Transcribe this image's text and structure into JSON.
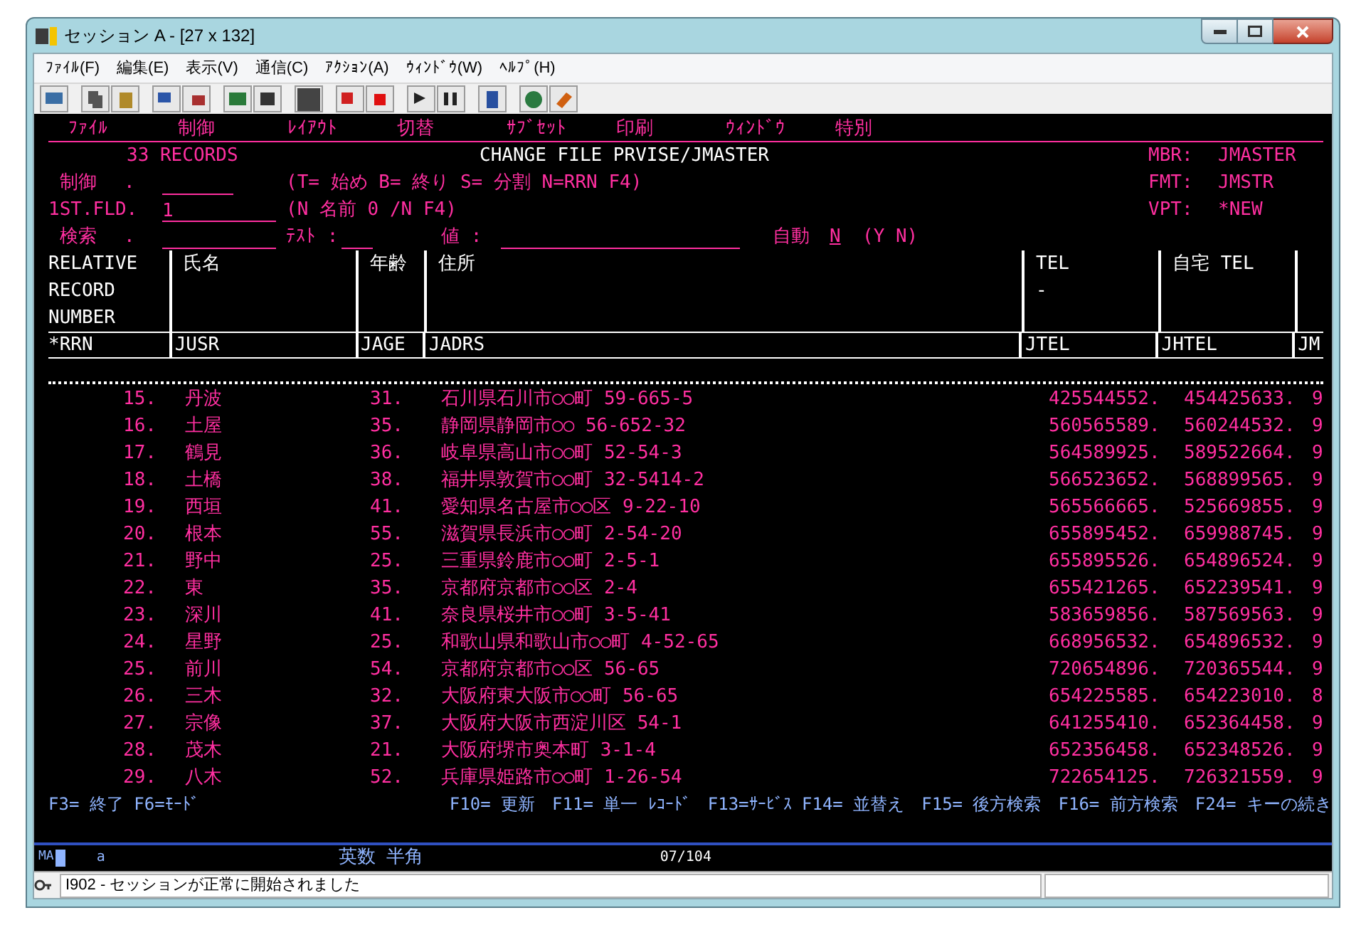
{
  "window": {
    "title": "セッション A - [27 x 132]"
  },
  "menu_bar": [
    "ﾌｧｲﾙ(F)",
    "編集(E)",
    "表示(V)",
    "通信(C)",
    "ｱｸｼｮﾝ(A)",
    "ｳｨﾝﾄﾞｳ(W)",
    "ﾍﾙﾌﾟ(H)"
  ],
  "terminal": {
    "action_bar": [
      "ﾌｧｲﾙ",
      "制御",
      "ﾚｲｱｳﾄ",
      "切替",
      "ｻﾌﾞｾｯﾄ",
      "印刷",
      "ｳｨﾝﾄﾞｳ",
      "特別"
    ],
    "record_count": "33 RECORDS",
    "screen_title": "CHANGE FILE PRVISE/JMASTER",
    "file_info": [
      {
        "label": "MBR:",
        "value": "JMASTER"
      },
      {
        "label": "FMT:",
        "value": "JMSTR"
      },
      {
        "label": "VPT:",
        "value": "*NEW"
      }
    ],
    "control": {
      "label": "制御",
      "dot": ".",
      "hint": "(T= 始め B= 終り S= 分割 N=RRN F4)"
    },
    "first_field": {
      "label": "1ST.FLD.",
      "value": "1",
      "hint": "(N 名前 0 /N F4)"
    },
    "search": {
      "label": "検索",
      "dot": ".",
      "test_label": "ﾃｽﾄ :",
      "value_label": "値 :",
      "auto_label": "自動",
      "auto_value": "N",
      "auto_options": "(Y N)"
    },
    "columns": [
      {
        "lines": [
          "RELATIVE",
          "RECORD",
          "NUMBER"
        ],
        "field": "*RRN"
      },
      {
        "lines": [
          "氏名"
        ],
        "field": "JUSR"
      },
      {
        "lines": [
          "年齢"
        ],
        "field": "JAGE"
      },
      {
        "lines": [
          "住所"
        ],
        "field": "JADRS"
      },
      {
        "lines": [
          "TEL",
          "-"
        ],
        "field": "JTEL"
      },
      {
        "lines": [
          "自宅 TEL"
        ],
        "field": "JHTEL"
      },
      {
        "field": "JM"
      }
    ],
    "rows": [
      [
        "15.",
        "丹波",
        "31.",
        "石川県石川市○○町 59-665-5",
        "425544552.",
        "454425633.",
        "9"
      ],
      [
        "16.",
        "土屋",
        "35.",
        "静岡県静岡市○○ 56-652-32",
        "560565589.",
        "560244532.",
        "9"
      ],
      [
        "17.",
        "鶴見",
        "36.",
        "岐阜県高山市○○町 52-54-3",
        "564589925.",
        "589522664.",
        "9"
      ],
      [
        "18.",
        "土橋",
        "38.",
        "福井県敦賀市○○町 32-5414-2",
        "566523652.",
        "568899565.",
        "9"
      ],
      [
        "19.",
        "西垣",
        "41.",
        "愛知県名古屋市○○区 9-22-10",
        "565566665.",
        "525669855.",
        "9"
      ],
      [
        "20.",
        "根本",
        "55.",
        "滋賀県長浜市○○町 2-54-20",
        "655895452.",
        "659988745.",
        "9"
      ],
      [
        "21.",
        "野中",
        "25.",
        "三重県鈴鹿市○○町 2-5-1",
        "655895526.",
        "654896524.",
        "9"
      ],
      [
        "22.",
        "東",
        "35.",
        "京都府京都市○○区 2-4",
        "655421265.",
        "652239541.",
        "9"
      ],
      [
        "23.",
        "深川",
        "41.",
        "奈良県桜井市○○町 3-5-41",
        "583659856.",
        "587569563.",
        "9"
      ],
      [
        "24.",
        "星野",
        "25.",
        "和歌山県和歌山市○○町 4-52-65",
        "668956532.",
        "654896532.",
        "9"
      ],
      [
        "25.",
        "前川",
        "54.",
        "京都府京都市○○区 56-65",
        "720654896.",
        "720365544.",
        "9"
      ],
      [
        "26.",
        "三木",
        "32.",
        "大阪府東大阪市○○町 56-65",
        "654225585.",
        "654223010.",
        "8"
      ],
      [
        "27.",
        "宗像",
        "37.",
        "大阪府大阪市西淀川区 54-1",
        "641255410.",
        "652364458.",
        "9"
      ],
      [
        "28.",
        "茂木",
        "21.",
        "大阪府堺市奥本町 3-1-4",
        "652356458.",
        "652348526.",
        "9"
      ],
      [
        "29.",
        "八木",
        "52.",
        "兵庫県姫路市○○町 1-26-54",
        "722654125.",
        "726321559.",
        "9"
      ]
    ],
    "function_keys": [
      "F3= 終了 F6=ﾓｰﾄﾞ",
      "F10= 更新",
      "F11= 単一 ﾚｺｰﾄﾞ",
      "F13=ｻｰﾋﾞｽ F14= 並替え",
      "F15= 後方検索",
      "F16= 前方検索",
      "F24= キーの続き"
    ],
    "operator_line": {
      "mode": "MA",
      "input": "a",
      "keyboard": "英数 半角",
      "cursor_position": "07/104"
    }
  },
  "status_bar": {
    "message": "I902 - セッションが正常に開始されました"
  }
}
